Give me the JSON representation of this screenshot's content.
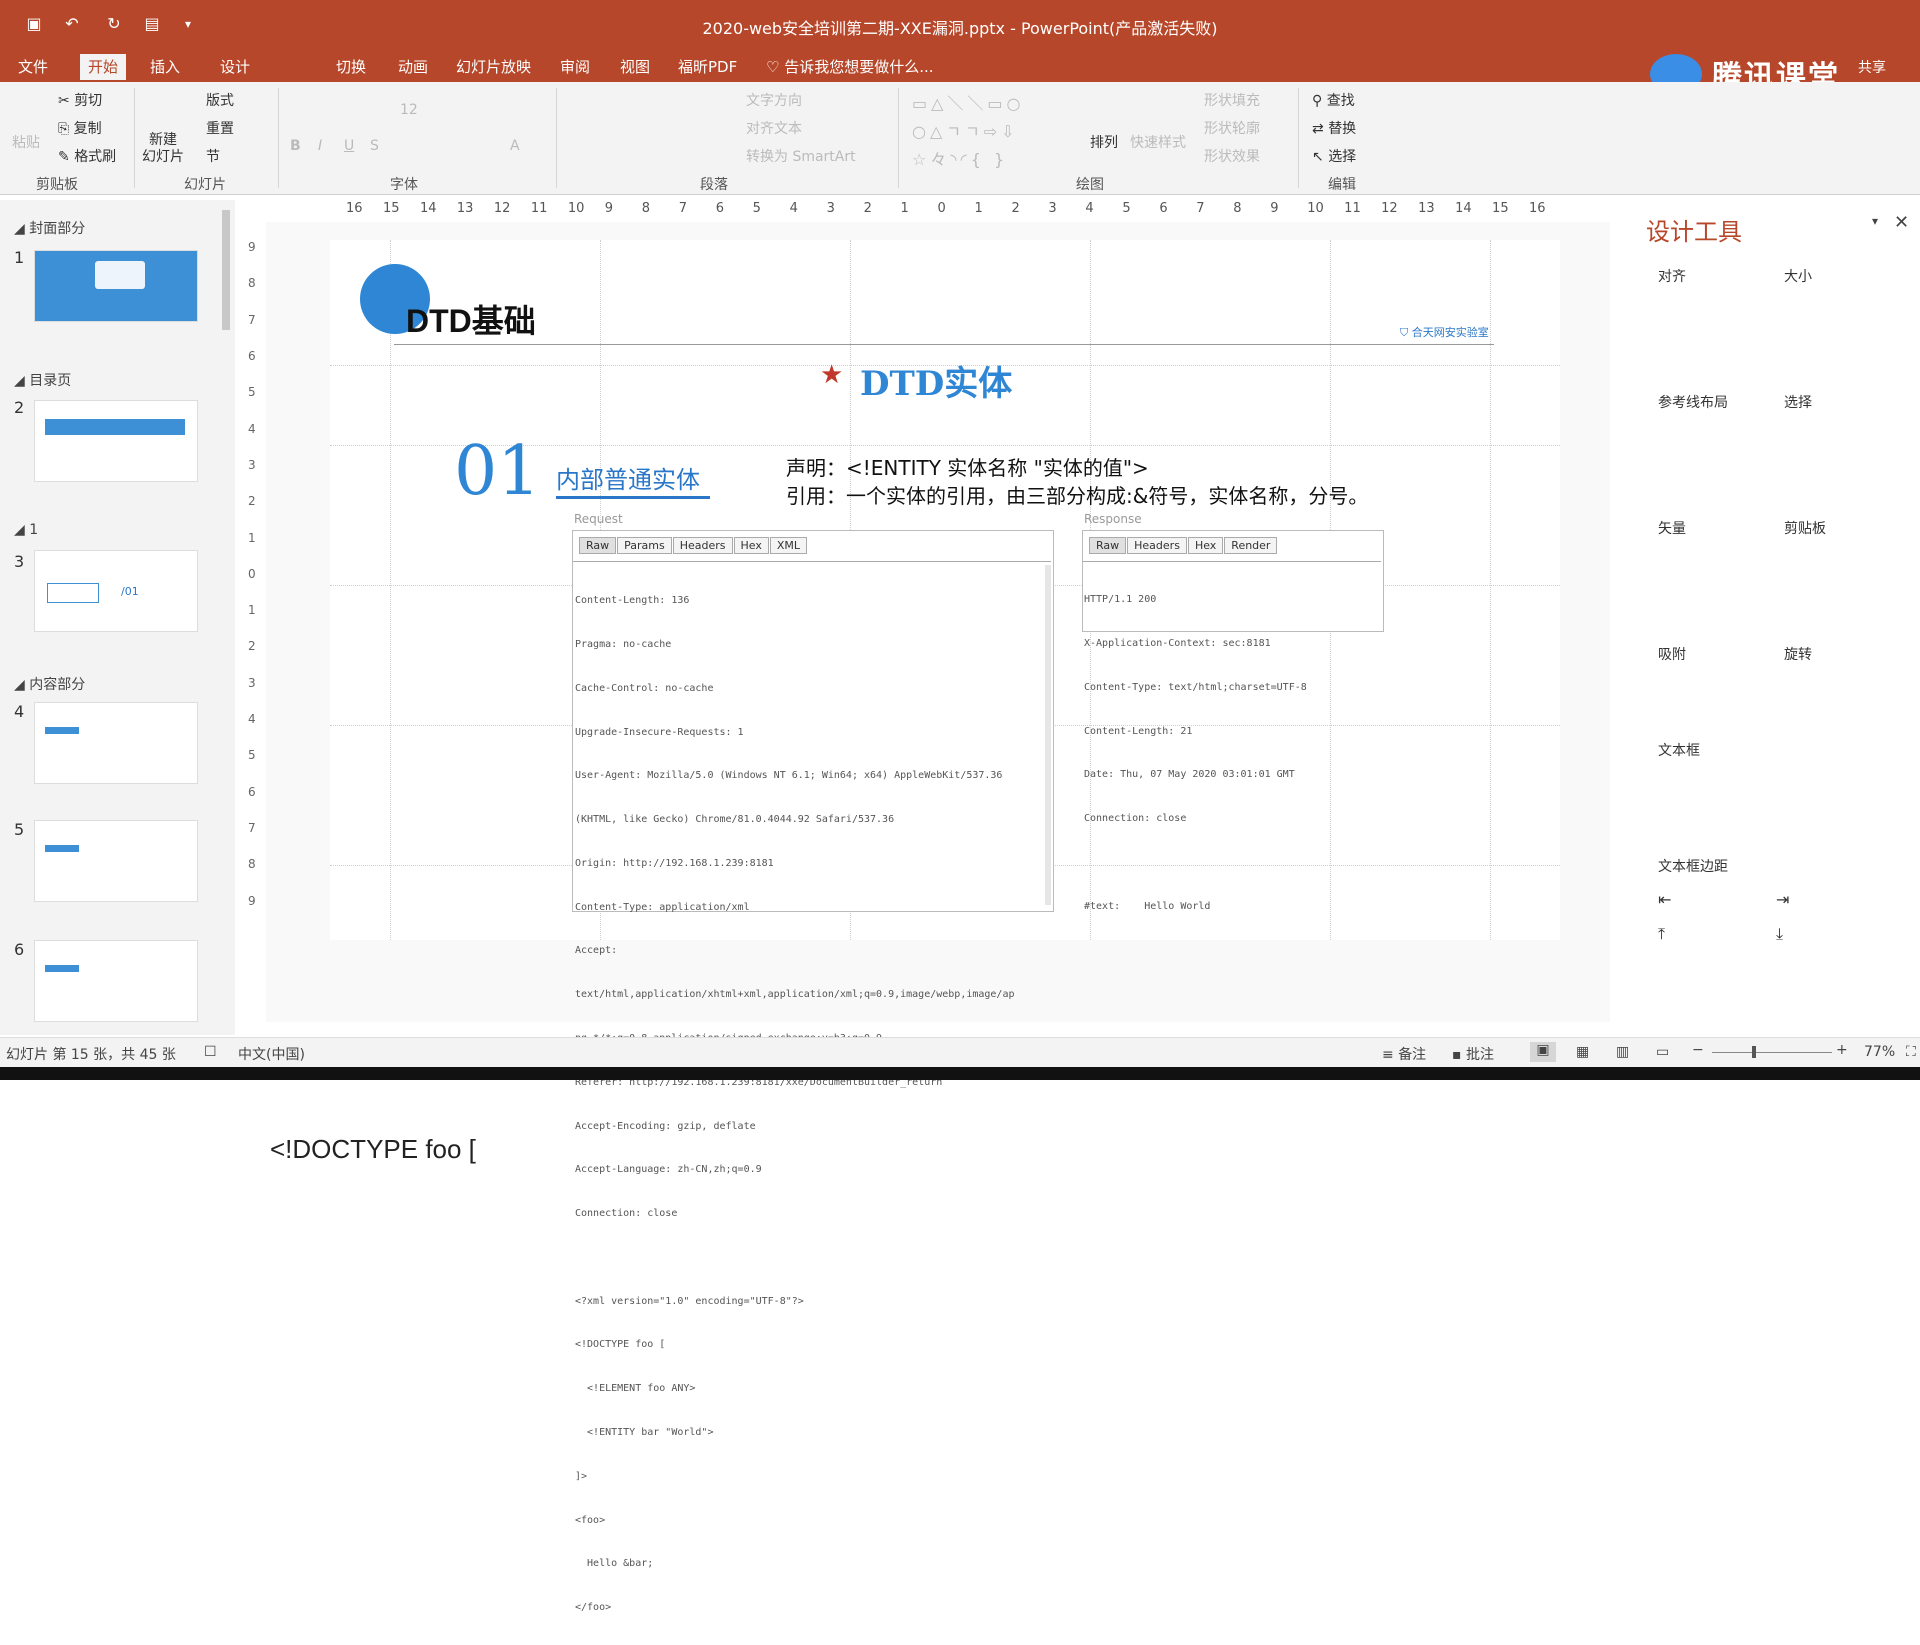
{
  "title_bar": {
    "text": "2020-web安全培训第二期-XXE漏洞.pptx - PowerPoint(产品激活失败)"
  },
  "tabs": [
    "文件",
    "开始",
    "插入",
    "设计",
    "切换",
    "动画",
    "幻灯片放映",
    "审阅",
    "视图",
    "福昕PDF"
  ],
  "tell_me": "告诉我您想要做什么...",
  "brand": "腾讯课堂",
  "share": "共享",
  "ribbon": {
    "clipboard": {
      "paste": "粘贴",
      "cut": "剪切",
      "copy": "复制",
      "format_painter": "格式刷",
      "group": "剪贴板"
    },
    "slides": {
      "new_slide": "新建\n幻灯片",
      "layout": "版式",
      "reset": "重置",
      "section": "节",
      "group": "幻灯片"
    },
    "font": {
      "group": "字体",
      "size": "12"
    },
    "paragraph": {
      "text_direction": "文字方向",
      "align_text": "对齐文本",
      "convert_smartart": "转换为 SmartArt",
      "group": "段落"
    },
    "drawing": {
      "arrange": "排列",
      "quick_styles": "快速样式",
      "shape_fill": "形状填充",
      "shape_outline": "形状轮廓",
      "shape_effects": "形状效果",
      "group": "绘图"
    },
    "editing": {
      "find": "查找",
      "replace": "替换",
      "select": "选择",
      "group": "编辑"
    }
  },
  "ruler_h": [
    "16",
    "15",
    "14",
    "13",
    "12",
    "11",
    "10",
    "9",
    "8",
    "7",
    "6",
    "5",
    "4",
    "3",
    "2",
    "1",
    "0",
    "1",
    "2",
    "3",
    "4",
    "5",
    "6",
    "7",
    "8",
    "9",
    "10",
    "11",
    "12",
    "13",
    "14",
    "15",
    "16"
  ],
  "ruler_v": [
    "9",
    "8",
    "7",
    "6",
    "5",
    "4",
    "3",
    "2",
    "1",
    "0",
    "1",
    "2",
    "3",
    "4",
    "5",
    "6",
    "7",
    "8",
    "9"
  ],
  "thumbnails": {
    "sections": [
      "封面部分",
      "目录页",
      "1",
      "内容部分"
    ],
    "numbers": [
      "1",
      "2",
      "3",
      "4",
      "5",
      "6"
    ],
    "thumb3_label": "/01"
  },
  "slide": {
    "header": "DTD基础",
    "logo_text": "合天网安实验室",
    "subtitle": "DTD实体",
    "number": "01",
    "section_title": "内部普通实体",
    "declare": "声明：<!ENTITY 实体名称 \"实体的值\">",
    "reference": "引用：一个实体的引用，由三部分构成:&符号，实体名称，分号。",
    "request": {
      "label": "Request",
      "tabs": [
        "Raw",
        "Params",
        "Headers",
        "Hex",
        "XML"
      ],
      "lines": [
        "Content-Length: 136",
        "Pragma: no-cache",
        "Cache-Control: no-cache",
        "Upgrade-Insecure-Requests: 1",
        "User-Agent: Mozilla/5.0 (Windows NT 6.1; Win64; x64) AppleWebKit/537.36",
        "(KHTML, like Gecko) Chrome/81.0.4044.92 Safari/537.36",
        "Origin: http://192.168.1.239:8181",
        "Content-Type: application/xml",
        "Accept:",
        "text/html,application/xhtml+xml,application/xml;q=0.9,image/webp,image/ap",
        "ng,*/*;q=0.8,application/signed-exchange;v=b3;q=0.9",
        "Referer: http://192.168.1.239:8181/xxe/DocumentBuilder_return",
        "Accept-Encoding: gzip, deflate",
        "Accept-Language: zh-CN,zh;q=0.9",
        "Connection: close",
        "",
        "<?xml version=\"1.0\" encoding=\"UTF-8\"?>",
        "<!DOCTYPE foo [",
        "  <!ELEMENT foo ANY>",
        "  <!ENTITY bar \"World\">",
        "]>",
        "<foo>",
        "  Hello &bar;",
        "</foo>"
      ]
    },
    "response": {
      "label": "Response",
      "tabs": [
        "Raw",
        "Headers",
        "Hex",
        "Render"
      ],
      "lines": [
        "HTTP/1.1 200",
        "X-Application-Context: sec:8181",
        "Content-Type: text/html;charset=UTF-8",
        "Content-Length: 21",
        "Date: Thu, 07 May 2020 03:01:01 GMT",
        "Connection: close",
        "",
        "#text:    Hello World"
      ]
    }
  },
  "notes_preview": [
    "<?xml version=\"1.0\" encoding=\"UTF-8\"?>",
    "<!DOCTYPE foo [",
    "  <!ELEMENT foo ANY>"
  ],
  "right_pane": {
    "title": "设计工具",
    "items": [
      "对齐",
      "大小",
      "参考线布局",
      "选择",
      "矢量",
      "剪贴板",
      "吸附",
      "旋转",
      "文本框",
      "文本框边距"
    ]
  },
  "status": {
    "slide_info": "幻灯片 第 15 张，共 45 张",
    "language": "中文(中国)",
    "notes": "备注",
    "comments": "批注",
    "zoom": "77%"
  },
  "colors": {
    "accent": "#b7472a",
    "slide_blue": "#2e86d4",
    "title_blue": "#2a77c9"
  }
}
